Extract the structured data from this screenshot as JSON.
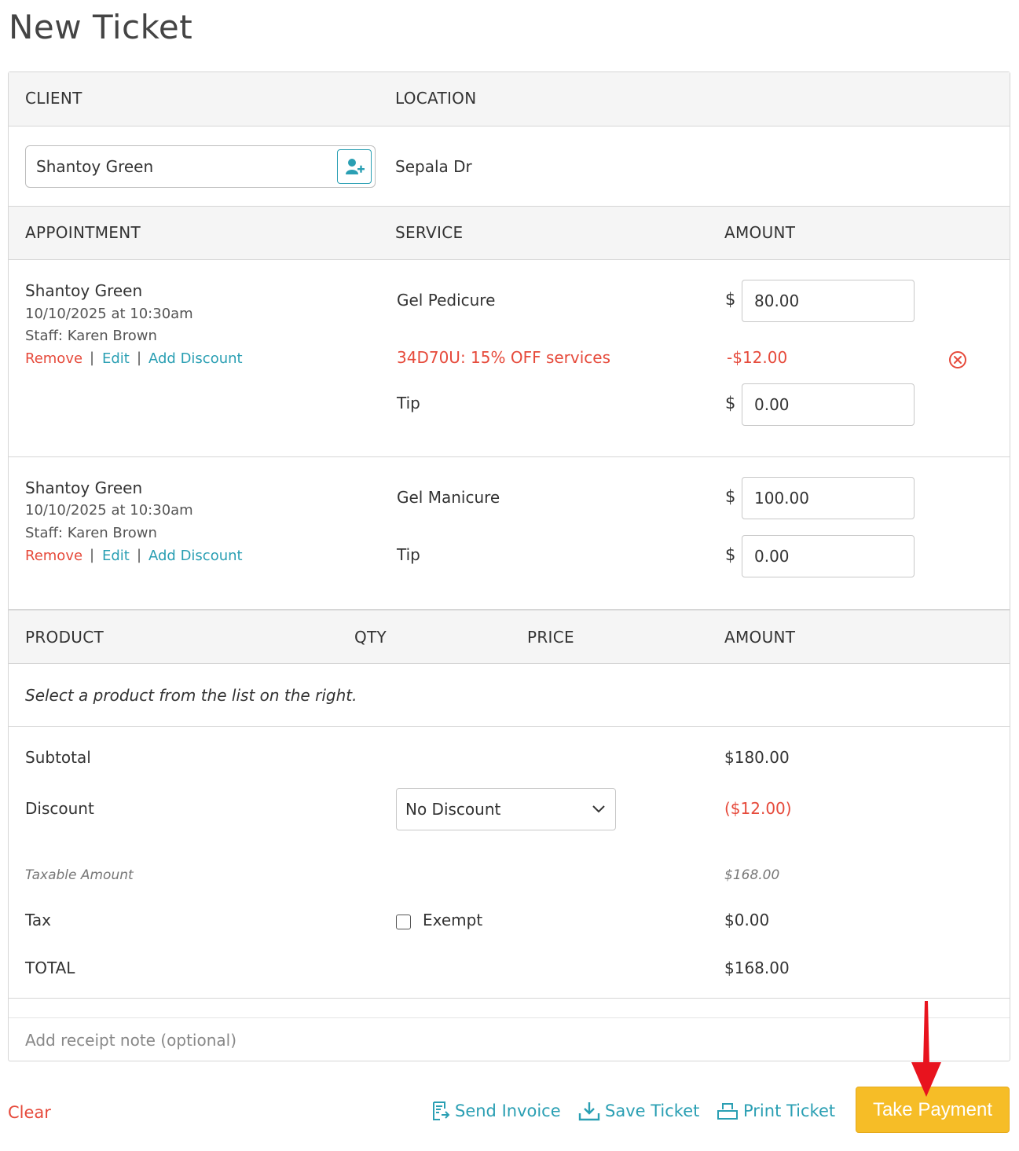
{
  "page_title": "New Ticket",
  "client_section": {
    "client_header": "CLIENT",
    "location_header": "LOCATION",
    "client_value": "Shantoy Green",
    "location_value": "Sepala Dr",
    "add_client_icon": "add-user-icon"
  },
  "appointment_section": {
    "headers": {
      "appointment": "APPOINTMENT",
      "service": "SERVICE",
      "amount": "AMOUNT"
    },
    "currency": "$",
    "appointments": [
      {
        "client": "Shantoy Green",
        "datetime": "10/10/2025 at 10:30am",
        "staff": "Staff: Karen Brown",
        "remove": "Remove",
        "edit": "Edit",
        "add_discount": "Add Discount",
        "sep": "|",
        "service": "Gel Pedicure",
        "amount": "80.00",
        "discount_label": "34D70U: 15% OFF services",
        "discount_amount": "-$12.00",
        "tip_label": "Tip",
        "tip_amount": "0.00"
      },
      {
        "client": "Shantoy Green",
        "datetime": "10/10/2025 at 10:30am",
        "staff": "Staff: Karen Brown",
        "remove": "Remove",
        "edit": "Edit",
        "add_discount": "Add Discount",
        "sep": "|",
        "service": "Gel Manicure",
        "amount": "100.00",
        "tip_label": "Tip",
        "tip_amount": "0.00"
      }
    ]
  },
  "product_section": {
    "headers": {
      "product": "PRODUCT",
      "qty": "QTY",
      "price": "PRICE",
      "amount": "AMOUNT"
    },
    "empty_message": "Select a product from the list on the right."
  },
  "totals": {
    "subtotal_label": "Subtotal",
    "subtotal_value": "$180.00",
    "discount_label": "Discount",
    "discount_select": "No Discount",
    "discount_value": "($12.00)",
    "taxable_label": "Taxable Amount",
    "taxable_value": "$168.00",
    "tax_label": "Tax",
    "exempt_label": "Exempt",
    "exempt_checked": false,
    "tax_value": "$0.00",
    "total_label": "TOTAL",
    "total_value": "$168.00"
  },
  "receipt_note": {
    "placeholder": "Add receipt note (optional)"
  },
  "footer": {
    "clear": "Clear",
    "send_invoice": "Send Invoice",
    "save_ticket": "Save Ticket",
    "print_ticket": "Print Ticket",
    "take_payment": "Take Payment"
  },
  "colors": {
    "accent": "#2a9fb3",
    "danger": "#e64a3b",
    "pay_button": "#f6bd27",
    "header_bg": "#f5f5f5"
  }
}
